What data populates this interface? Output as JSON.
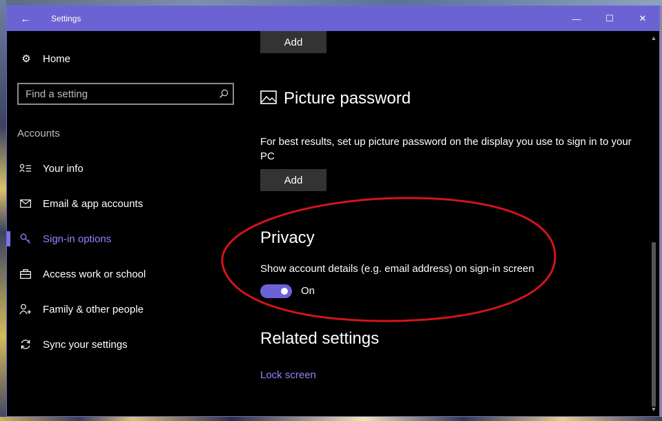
{
  "window": {
    "title": "Settings",
    "controls": {
      "minimize": "—",
      "maximize": "☐",
      "close": "✕"
    }
  },
  "sidebar": {
    "home_label": "Home",
    "search_placeholder": "Find a setting",
    "section_label": "Accounts",
    "items": [
      {
        "label": "Your info",
        "icon": "person-list-icon",
        "active": false
      },
      {
        "label": "Email & app accounts",
        "icon": "mail-icon",
        "active": false
      },
      {
        "label": "Sign-in options",
        "icon": "key-icon",
        "active": true
      },
      {
        "label": "Access work or school",
        "icon": "briefcase-icon",
        "active": false
      },
      {
        "label": "Family & other people",
        "icon": "person-add-icon",
        "active": false
      },
      {
        "label": "Sync your settings",
        "icon": "sync-icon",
        "active": false
      }
    ]
  },
  "main": {
    "top_add_label": "Add",
    "picture_password": {
      "heading": "Picture password",
      "description": "For best results, set up picture password on the display you use to sign in to your PC",
      "add_label": "Add"
    },
    "privacy": {
      "heading": "Privacy",
      "description": "Show account details (e.g. email address) on sign-in screen",
      "toggle_state": "On",
      "toggle_on": true
    },
    "related": {
      "heading": "Related settings",
      "link": "Lock screen"
    }
  },
  "colors": {
    "accent": "#6b63d3",
    "link": "#8f86ff",
    "annotation": "#d4141a",
    "background": "#000000"
  }
}
